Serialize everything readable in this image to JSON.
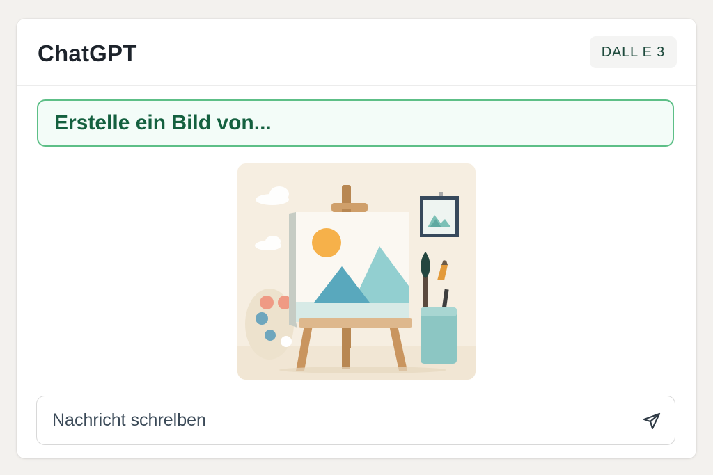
{
  "header": {
    "title": "ChatGPT",
    "model_badge": "DALL E 3"
  },
  "prompt": {
    "text": "Erstelle ein Bild von..."
  },
  "generated_image": {
    "subject": "artist easel with landscape canvas, paint palette, brushes in cup, framed picture"
  },
  "composer": {
    "placeholder": "Nachricht schrelben",
    "value": ""
  },
  "icons": {
    "send": "send-icon"
  },
  "colors": {
    "accent_green": "#5dbf87",
    "prompt_text": "#14603f",
    "prompt_bg": "#f3fcf8",
    "title_text": "#1d232b",
    "page_bg": "#f3f1ee"
  }
}
